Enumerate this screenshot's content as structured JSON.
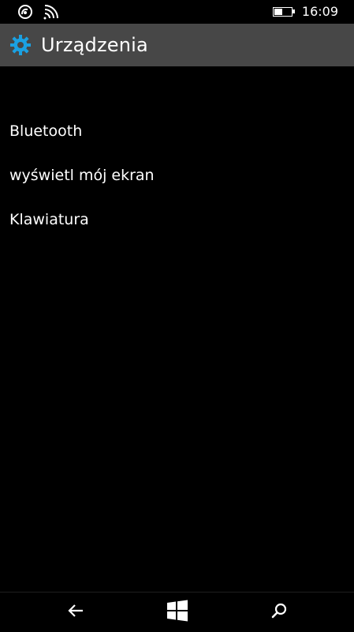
{
  "status_bar": {
    "time": "16:09",
    "battery_level": 0.45,
    "icons": [
      "nfc-icon",
      "wifi-icon",
      "battery-icon"
    ]
  },
  "header": {
    "title": "Urządzenia",
    "icon": "gear-icon",
    "accent_color": "#1ba1e2",
    "background": "#474747"
  },
  "menu": {
    "items": [
      {
        "label": "Bluetooth"
      },
      {
        "label": "wyświetl mój ekran"
      },
      {
        "label": "Klawiatura"
      }
    ]
  },
  "nav_bar": {
    "icons": [
      "back-arrow-icon",
      "windows-start-icon",
      "search-icon"
    ]
  }
}
